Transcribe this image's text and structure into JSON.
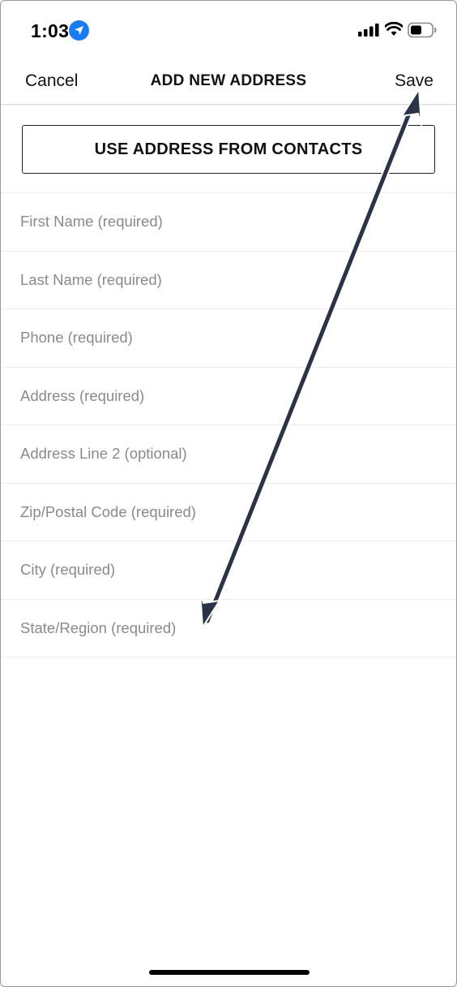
{
  "status_bar": {
    "time": "1:03",
    "location_icon": "location-arrow-icon",
    "signal_icon": "cellular-signal-icon",
    "wifi_icon": "wifi-icon",
    "battery_icon": "battery-icon"
  },
  "nav": {
    "cancel_label": "Cancel",
    "title": "ADD NEW ADDRESS",
    "save_label": "Save"
  },
  "contacts_button_label": "USE ADDRESS FROM CONTACTS",
  "form": {
    "fields": [
      {
        "placeholder": "First Name (required)",
        "value": ""
      },
      {
        "placeholder": "Last Name (required)",
        "value": ""
      },
      {
        "placeholder": "Phone (required)",
        "value": ""
      },
      {
        "placeholder": "Address (required)",
        "value": ""
      },
      {
        "placeholder": "Address Line 2 (optional)",
        "value": ""
      },
      {
        "placeholder": "Zip/Postal Code (required)",
        "value": ""
      },
      {
        "placeholder": "City (required)",
        "value": ""
      },
      {
        "placeholder": "State/Region (required)",
        "value": ""
      }
    ]
  },
  "colors": {
    "accent": "#1a7cf5",
    "arrow": "#2b3447",
    "placeholder": "#8a8a8a"
  }
}
